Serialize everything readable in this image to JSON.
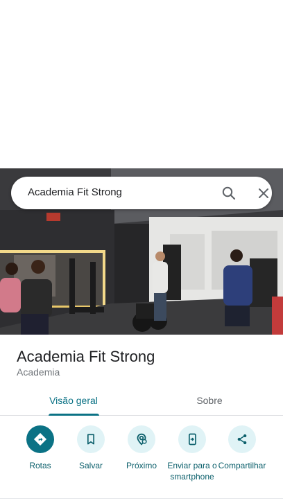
{
  "search": {
    "query": "Academia Fit Strong"
  },
  "place": {
    "name": "Academia Fit Strong",
    "category": "Academia"
  },
  "tabs": [
    {
      "label": "Visão geral",
      "active": true
    },
    {
      "label": "Sobre",
      "active": false
    }
  ],
  "actions": [
    {
      "label": "Rotas",
      "icon": "directions-icon",
      "primary": true
    },
    {
      "label": "Salvar",
      "icon": "bookmark-icon",
      "primary": false
    },
    {
      "label": "Próximo",
      "icon": "nearby-icon",
      "primary": false
    },
    {
      "label": "Enviar para o smartphone",
      "icon": "send-to-phone-icon",
      "primary": false
    },
    {
      "label": "Compartilhar",
      "icon": "share-icon",
      "primary": false
    }
  ],
  "colors": {
    "accent": "#0b7285",
    "action_bg": "#e0f3f6",
    "text": "#202124",
    "secondary_text": "#70757a"
  }
}
